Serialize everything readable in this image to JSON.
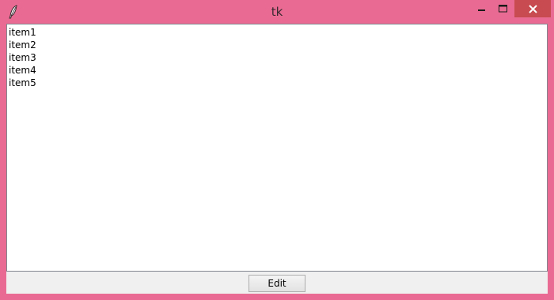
{
  "window": {
    "title": "tk",
    "titlebar_color": "#e96b93",
    "close_button_color": "#c74b50",
    "app_icon": "feather-icon"
  },
  "controls": {
    "minimize_icon": "minimize-icon",
    "maximize_icon": "maximize-icon",
    "close_icon": "close-icon"
  },
  "listbox": {
    "items": [
      "item1",
      "item2",
      "item3",
      "item4",
      "item5"
    ]
  },
  "buttons": {
    "edit_label": "Edit"
  }
}
